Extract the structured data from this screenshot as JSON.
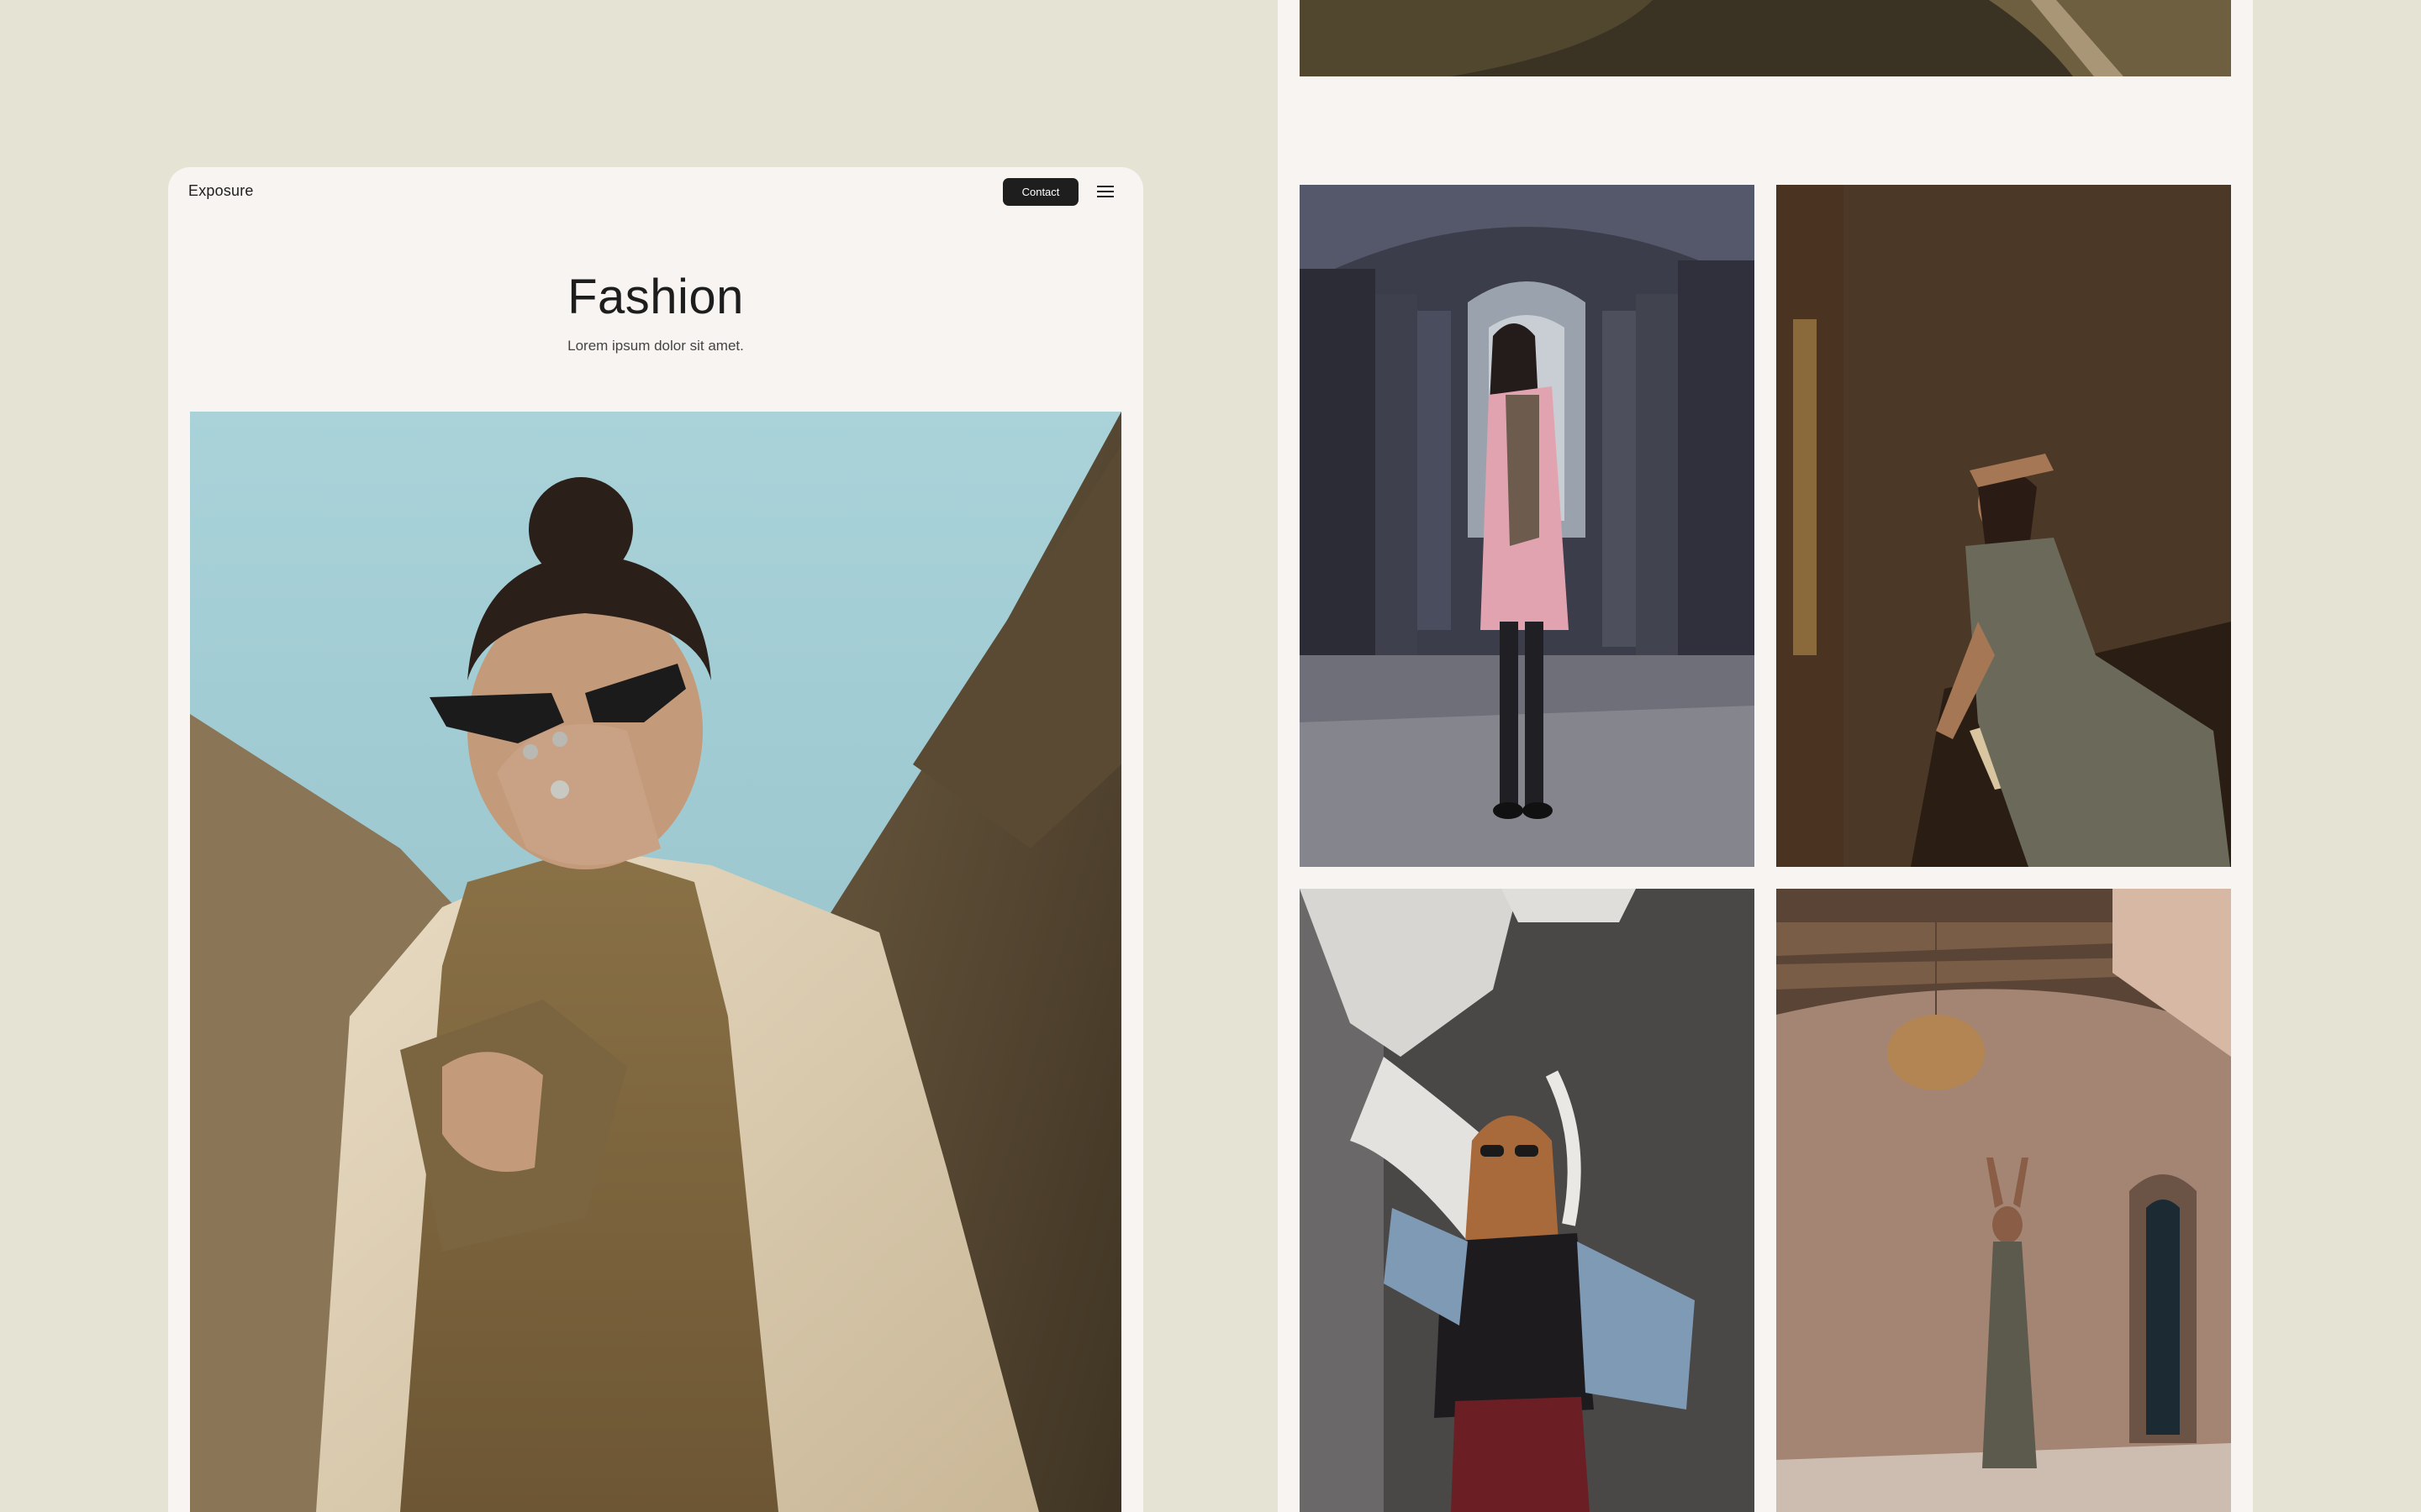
{
  "site": {
    "brand": "Exposure",
    "contact_label": "Contact",
    "menu_icon": "hamburger-menu-icon"
  },
  "hero": {
    "title": "Fashion",
    "subtitle": "Lorem ipsum dolor sit amet."
  },
  "gallery": {
    "photos": [
      "top-cropped-photo",
      "woman-pink-coat-arcade-photo",
      "woman-shading-eyes-sunlight-photo",
      "woman-sunglasses-mural-photo",
      "woman-dress-arched-room-photo"
    ]
  },
  "colors": {
    "background": "#e5e3d3",
    "card": "#f7f4f2",
    "button": "#1e1e1e",
    "text": "#1d1d1d"
  }
}
